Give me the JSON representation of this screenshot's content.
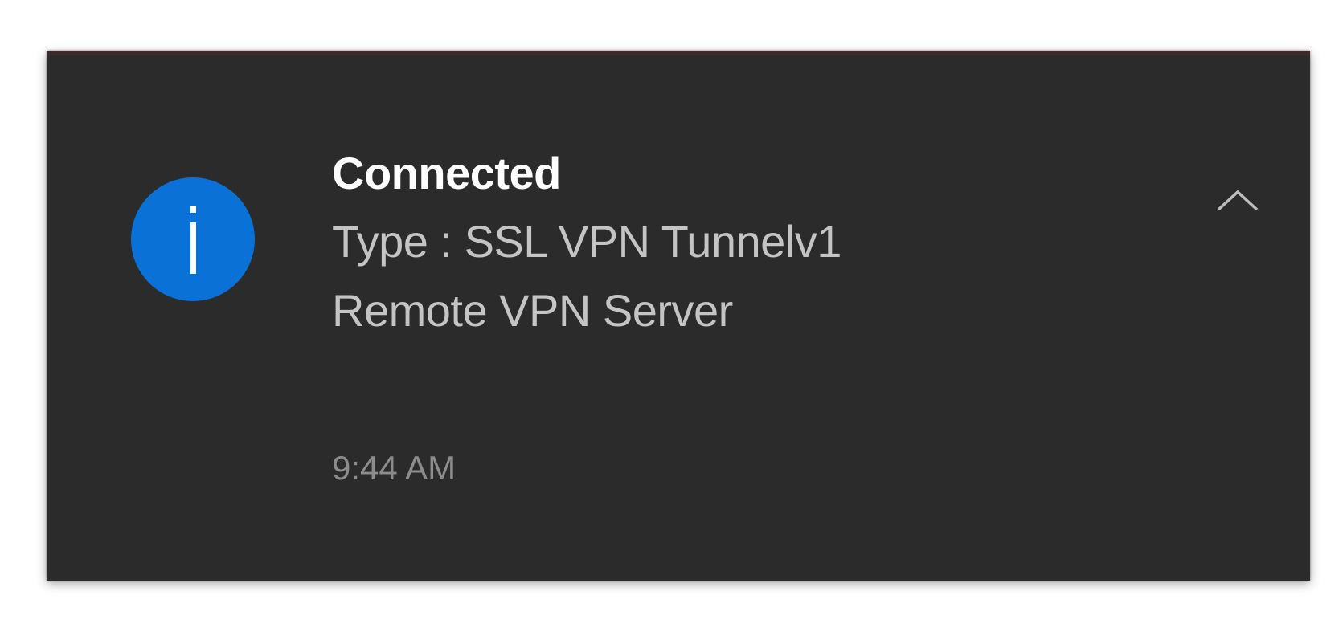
{
  "notification": {
    "title": "Connected",
    "lines": [
      "Type : SSL VPN Tunnelv1",
      "Remote VPN Server"
    ],
    "time": "9:44 AM",
    "icon": "info-icon",
    "collapse_icon": "chevron-up-icon",
    "colors": {
      "background": "#2b2b2b",
      "accent": "#0a72d6",
      "title": "#ffffff",
      "body": "#c4c4c4",
      "time": "#8c8c8c"
    }
  }
}
